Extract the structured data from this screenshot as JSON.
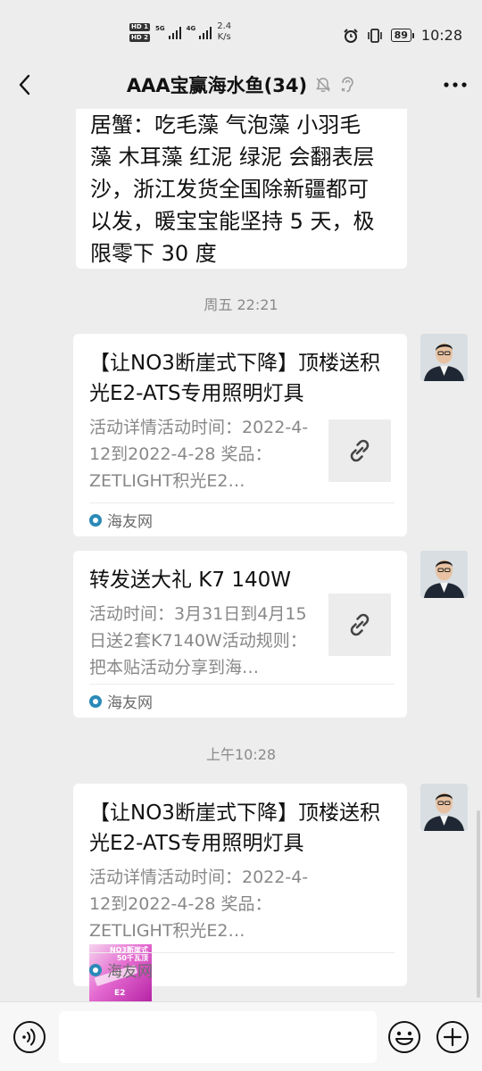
{
  "status_bar": {
    "hd1": "HD 1",
    "hd2": "HD 2",
    "sig1_label": "5G",
    "sig2_label": "4G",
    "speed_value": "2.4",
    "speed_unit": "K/s",
    "battery": "89",
    "time": "10:28",
    "icons": [
      "alarm-icon",
      "vibrate-icon",
      "battery-icon"
    ]
  },
  "header": {
    "title": "AAA宝赢海水鱼(34)",
    "icons": [
      "back-icon",
      "mute-bell-icon",
      "earpiece-icon",
      "more-icon"
    ]
  },
  "messages": [
    {
      "type": "text",
      "lines": [
        "居蟹：吃毛藻 气泡藻 小羽毛",
        "藻 木耳藻 红泥 绿泥 会翻表层",
        "沙，浙江发货全国除新疆都可",
        "以发，暖宝宝能坚持 5 天，极",
        "限零下 30 度"
      ]
    },
    {
      "type": "time",
      "text": "周五 22:21"
    },
    {
      "type": "link",
      "title": "【让NO3断崖式下降】顶楼送积光E2-ATS专用照明灯具",
      "desc": "活动详情活动时间：2022-4-12到2022-4-28 奖品：ZETLIGHT积光E2…",
      "source": "海友网",
      "thumb": "link-icon"
    },
    {
      "type": "link",
      "title": "转发送大礼 K7 140W",
      "desc": "活动时间：3月31日到4月15日送2套K7140W活动规则：把本贴活动分享到海…",
      "source": "海友网",
      "thumb": "link-icon"
    },
    {
      "type": "time",
      "text": "上午10:28"
    },
    {
      "type": "link",
      "title": "【让NO3断崖式下降】顶楼送积光E2-ATS专用照明灯具",
      "desc": "活动详情活动时间：2022-4-12到2022-4-28 奖品：ZETLIGHT积光E2…",
      "source": "海友网",
      "thumb": "promo-image",
      "thumb_text_1": "NO3断崖式",
      "thumb_text_2": "50千瓦顶",
      "thumb_text_3": "E2"
    }
  ],
  "input_bar": {
    "placeholder": "",
    "icons": [
      "voice-icon",
      "emoji-icon",
      "plus-icon"
    ]
  },
  "colors": {
    "background": "#ededed",
    "bubble": "#ffffff",
    "link_icon": "#444444",
    "source_icon": "#2a8ab8"
  }
}
